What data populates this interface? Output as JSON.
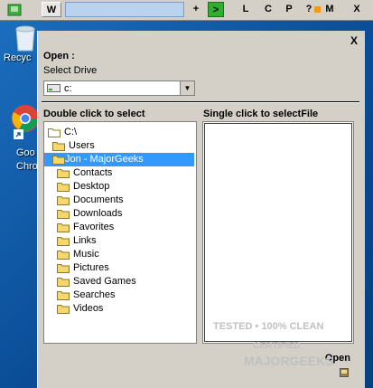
{
  "toolbar": {
    "w_label": "W",
    "buttons": [
      "+",
      ">",
      "L",
      "C",
      "P",
      "?",
      "M",
      "X"
    ],
    "active_accent": "#2fae2f"
  },
  "desktop": {
    "recycle_label": "Recyc",
    "chrome_label_1": "Goo",
    "chrome_label_2": "Chro"
  },
  "dialog": {
    "close_label": "X",
    "open_label": "Open :",
    "select_drive_label": "Select Drive",
    "drive_value": "c:",
    "left_header": "Double click to select",
    "right_header": "Single click to selectFile",
    "open_button_label": "Open",
    "tree_items": [
      {
        "label": "C:\\",
        "indent": 0,
        "selected": false
      },
      {
        "label": "Users",
        "indent": 1,
        "selected": false
      },
      {
        "label": "Jon - MajorGeeks",
        "indent": 2,
        "selected": true
      },
      {
        "label": "Contacts",
        "indent": 3,
        "selected": false
      },
      {
        "label": "Desktop",
        "indent": 3,
        "selected": false
      },
      {
        "label": "Documents",
        "indent": 3,
        "selected": false
      },
      {
        "label": "Downloads",
        "indent": 3,
        "selected": false
      },
      {
        "label": "Favorites",
        "indent": 3,
        "selected": false
      },
      {
        "label": "Links",
        "indent": 3,
        "selected": false
      },
      {
        "label": "Music",
        "indent": 3,
        "selected": false
      },
      {
        "label": "Pictures",
        "indent": 3,
        "selected": false
      },
      {
        "label": "Saved Games",
        "indent": 3,
        "selected": false
      },
      {
        "label": "Searches",
        "indent": 3,
        "selected": false
      },
      {
        "label": "Videos",
        "indent": 3,
        "selected": false
      }
    ]
  },
  "watermark": {
    "line1": "TESTED • 100% CLEAN",
    "line2": "CERTIFIED",
    "line3": "MAJORGEEKS"
  }
}
